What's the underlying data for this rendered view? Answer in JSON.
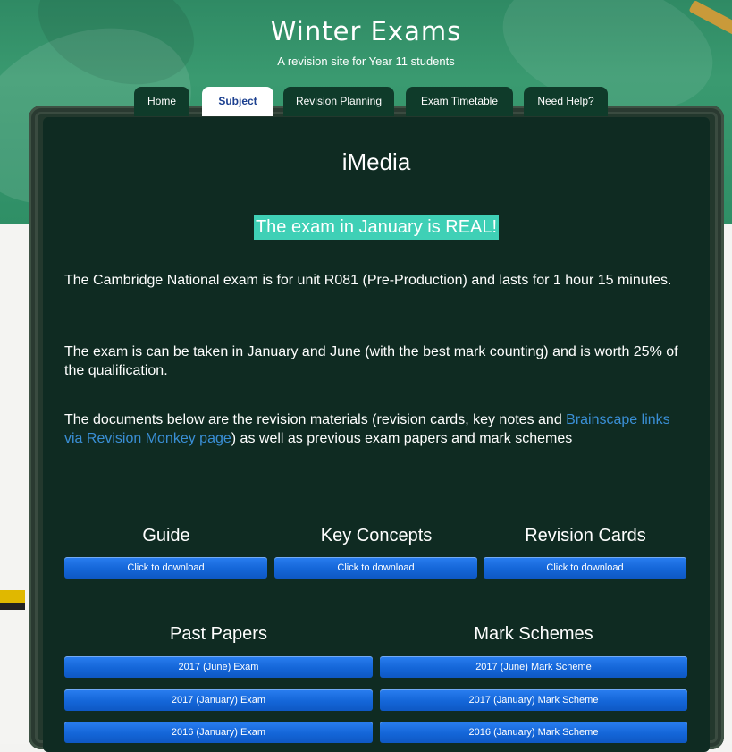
{
  "site": {
    "title": "Winter Exams",
    "subtitle": "A revision site for Year 11 students"
  },
  "nav": {
    "tabs": [
      {
        "label": "Home",
        "active": false
      },
      {
        "label": "Subject",
        "active": true
      },
      {
        "label": "Revision Planning",
        "active": false
      },
      {
        "label": "Exam Timetable",
        "active": false
      },
      {
        "label": "Need Help?",
        "active": false
      }
    ]
  },
  "page": {
    "title": "iMedia",
    "alert": "The exam in January is REAL!",
    "para1": "The Cambridge National exam is for unit R081 (Pre-Production) and lasts for 1 hour 15 minutes.",
    "para2": "The exam is can be taken in January and June (with the best mark counting) and is worth 25% of the qualification.",
    "para3_before": "The documents below are the revision materials (revision cards, key notes and ",
    "para3_link": "Brainscape links via Revision Monkey page",
    "para3_after": ") as well as previous exam papers and mark schemes"
  },
  "downloads": [
    {
      "heading": "Guide",
      "button": "Click to download"
    },
    {
      "heading": "Key Concepts",
      "button": "Click to download"
    },
    {
      "heading": "Revision Cards",
      "button": "Click to download"
    }
  ],
  "past_papers": {
    "heading": "Past Papers",
    "items": [
      "2017 (June) Exam",
      "2017 (January) Exam",
      "2016 (January) Exam"
    ]
  },
  "mark_schemes": {
    "heading": "Mark Schemes",
    "items": [
      "2017 (June) Mark Scheme",
      "2017 (January) Mark Scheme",
      "2016 (January) Mark Scheme"
    ]
  },
  "colors": {
    "alert_bg": "#3fd0b6",
    "button_blue": "#1466d8",
    "panel_bg": "#0f2b22",
    "link": "#3a8fd6"
  }
}
